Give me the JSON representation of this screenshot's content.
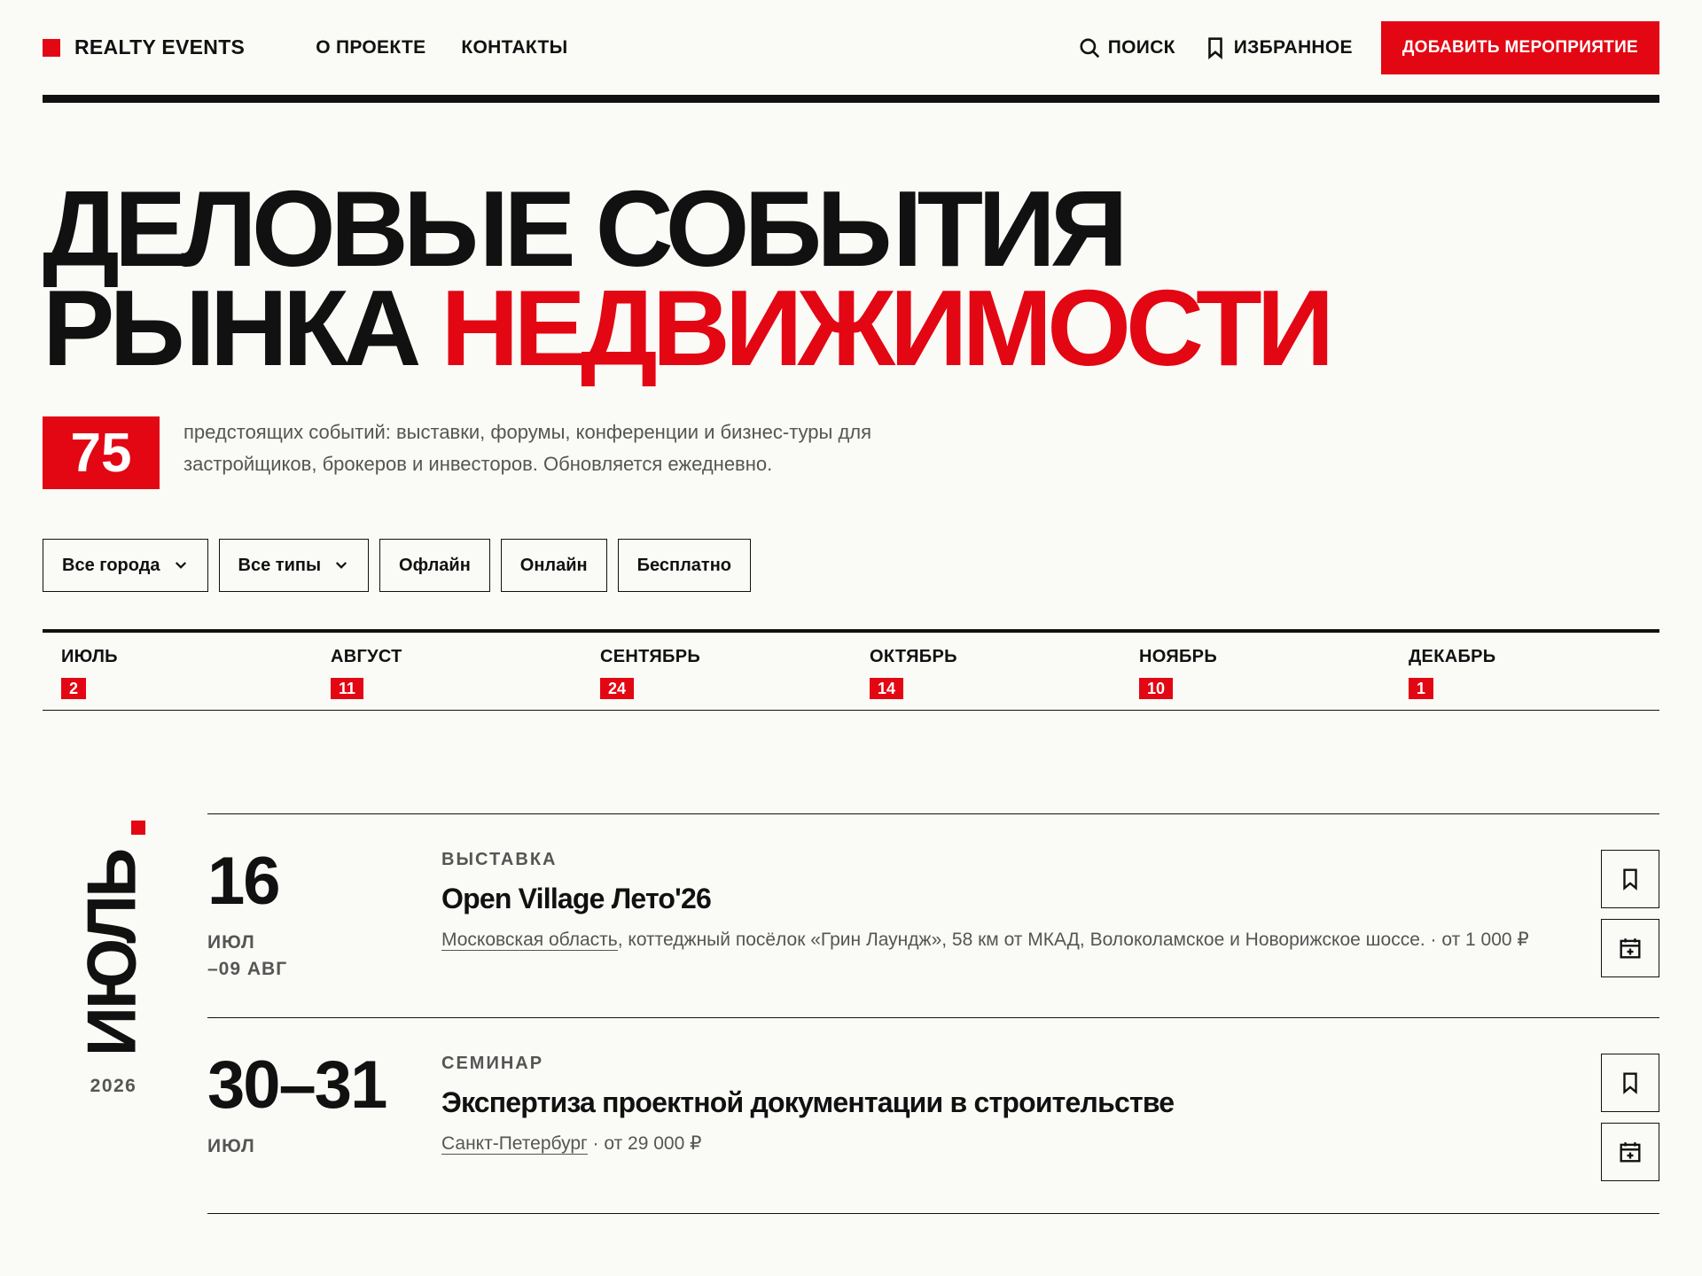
{
  "header": {
    "brand": "REALTY EVENTS",
    "nav": [
      "О ПРОЕКТЕ",
      "КОНТАКТЫ"
    ],
    "search_label": "ПОИСК",
    "favorites_label": "ИЗБРАННОЕ",
    "add_event_label": "ДОБАВИТЬ МЕРОПРИЯТИЕ"
  },
  "hero": {
    "title_line1": "ДЕЛОВЫЕ СОБЫТИЯ",
    "title_line2_black": "РЫНКА",
    "title_line2_red": "НЕДВИЖИМОСТИ",
    "count": "75",
    "description": "предстоящих событий: выставки, форумы, конференции и бизнес-туры для застройщиков, брокеров и инвесторов. Обновляется ежедневно."
  },
  "filters": {
    "city": "Все города",
    "type": "Все типы",
    "offline": "Офлайн",
    "online": "Онлайн",
    "free": "Бесплатно"
  },
  "months": [
    {
      "name": "ИЮЛЬ",
      "count": "2"
    },
    {
      "name": "АВГУСТ",
      "count": "11"
    },
    {
      "name": "СЕНТЯБРЬ",
      "count": "24"
    },
    {
      "name": "ОКТЯБРЬ",
      "count": "14"
    },
    {
      "name": "НОЯБРЬ",
      "count": "10"
    },
    {
      "name": "ДЕКАБРЬ",
      "count": "1"
    }
  ],
  "section": {
    "month": "ИЮЛЬ",
    "year": "2026"
  },
  "events": [
    {
      "day": "16",
      "month_line1": "ИЮЛ",
      "month_line2": "–09 АВГ",
      "type": "ВЫСТАВКА",
      "title": "Open Village Лето'26",
      "location": "Московская область",
      "details": ", коттеджный посёлок «Грин Лаундж», 58 км от МКАД, Волоколамское и Новорижское шоссе. · от 1 000 ₽"
    },
    {
      "day": "30–31",
      "month_line1": "ИЮЛ",
      "type": "СЕМИНАР",
      "title": "Экспертиза проектной документации в строительстве",
      "location": "Санкт-Петербург",
      "details": " · от 29 000 ₽"
    }
  ],
  "colors": {
    "accent": "#e30613",
    "text": "#111111",
    "muted": "#555555",
    "background": "#fafaf7"
  },
  "icons": [
    "search-icon",
    "bookmark-icon",
    "chevron-down-icon",
    "calendar-add-icon"
  ]
}
